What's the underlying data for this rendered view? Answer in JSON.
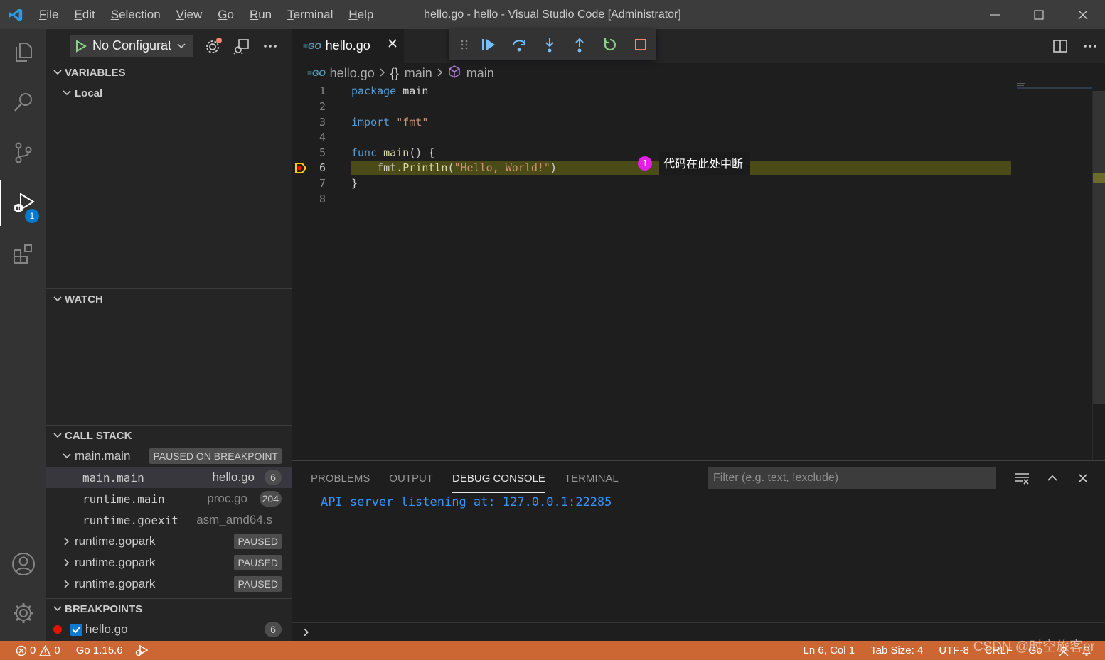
{
  "titlebar": {
    "title": "hello.go - hello - Visual Studio Code [Administrator]",
    "menu": [
      {
        "first": "F",
        "rest": "ile"
      },
      {
        "first": "E",
        "rest": "dit"
      },
      {
        "first": "S",
        "rest": "election"
      },
      {
        "first": "V",
        "rest": "iew"
      },
      {
        "first": "G",
        "rest": "o"
      },
      {
        "first": "R",
        "rest": "un"
      },
      {
        "first": "T",
        "rest": "erminal"
      },
      {
        "first": "H",
        "rest": "elp"
      }
    ]
  },
  "activitybar": {
    "debug_badge": "1"
  },
  "sidebar": {
    "config_label": "No Configurat",
    "variables_header": "VARIABLES",
    "local_label": "Local",
    "watch_header": "WATCH",
    "callstack_header": "CALL STACK",
    "thread": {
      "name": "main.main",
      "status": "PAUSED ON BREAKPOINT"
    },
    "frames": [
      {
        "name": "main.main",
        "file": "hello.go",
        "line": "6"
      },
      {
        "name": "runtime.main",
        "file": "proc.go",
        "line": "204"
      },
      {
        "name": "runtime.goexit",
        "file": "asm_amd64.s",
        "line": ""
      }
    ],
    "goroutines": [
      {
        "name": "runtime.gopark",
        "status": "PAUSED"
      },
      {
        "name": "runtime.gopark",
        "status": "PAUSED"
      },
      {
        "name": "runtime.gopark",
        "status": "PAUSED"
      }
    ],
    "breakpoints_header": "BREAKPOINTS",
    "breakpoint": {
      "file": "hello.go",
      "line": "6"
    }
  },
  "editor": {
    "tab_label": "hello.go",
    "breadcrumb": {
      "file": "hello.go",
      "scope": "main",
      "symbol": "main",
      "braces": "{}"
    },
    "line_numbers": [
      "1",
      "2",
      "3",
      "4",
      "5",
      "6",
      "7",
      "8"
    ],
    "code": {
      "l1_kw": "package",
      "l1_rest": " main",
      "l3_kw": "import",
      "l3_str": "\"fmt\"",
      "l5_kw": "func",
      "l5_fn": "main",
      "l5_rest": "() {",
      "l6_pre": "    fmt.",
      "l6_fn": "Println",
      "l6_open": "(",
      "l6_str": "\"Hello, World!\"",
      "l6_close": ")",
      "l7": "}"
    },
    "inline_note_index": "1",
    "inline_note": "代码在此处中断"
  },
  "panel": {
    "tabs": [
      "PROBLEMS",
      "OUTPUT",
      "DEBUG CONSOLE",
      "TERMINAL"
    ],
    "active_tab": "DEBUG CONSOLE",
    "filter_placeholder": "Filter (e.g. text, !exclude)",
    "console_output": "API server listening at: 127.0.0.1:22285",
    "prompt": "›"
  },
  "statusbar": {
    "errors": "0",
    "warnings": "0",
    "go_version": "Go 1.15.6",
    "position": "Ln 6, Col 1",
    "tab_size": "Tab Size: 4",
    "encoding": "UTF-8",
    "eol": "CRLF",
    "language": "Go",
    "watermark": "CSDN @时空旅客er"
  },
  "colors": {
    "statusbar_debug": "#cc6633",
    "accent": "#007acc",
    "breakpoint": "#e51400",
    "current_line": "#4b4b18"
  }
}
